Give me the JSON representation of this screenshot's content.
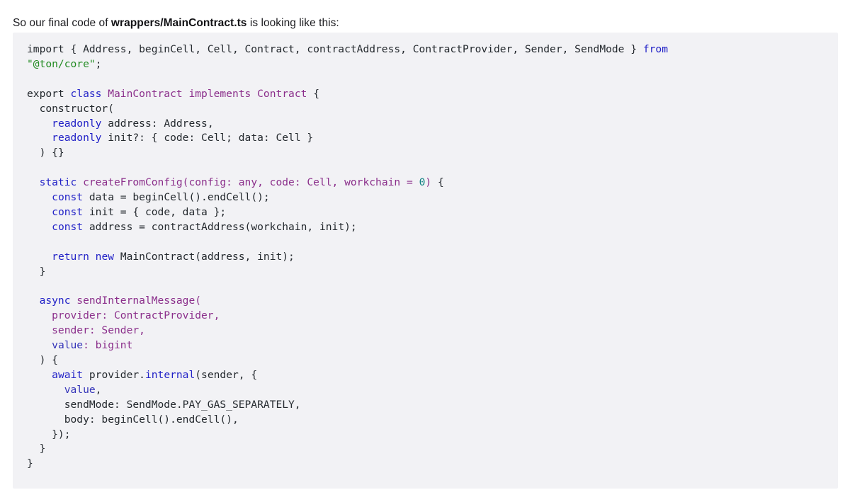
{
  "intro": {
    "prefix": "So our final code of ",
    "filename": "wrappers/MainContract.ts",
    "suffix": " is looking like this:"
  },
  "code_block": {
    "language": "typescript",
    "background_color": "#f2f2f5",
    "theme_colors": {
      "keyword": "#2222c7",
      "type": "#8b2f8b",
      "string": "#228b22",
      "number": "#0d8080",
      "plain": "#24292e"
    },
    "lines": [
      [
        {
          "t": "import { Address, beginCell, Cell, Contract, contractAddress, ContractProvider, Sender, SendMode } ",
          "c": "tok-pln"
        },
        {
          "t": "from",
          "c": "tok-kw"
        }
      ],
      [
        {
          "t": "\"@ton/core\"",
          "c": "tok-str"
        },
        {
          "t": ";",
          "c": "tok-pln"
        }
      ],
      [],
      [
        {
          "t": "export ",
          "c": "tok-pln"
        },
        {
          "t": "class ",
          "c": "tok-kw"
        },
        {
          "t": "MainContract ",
          "c": "tok-typ"
        },
        {
          "t": "implements ",
          "c": "tok-typ"
        },
        {
          "t": "Contract ",
          "c": "tok-typ"
        },
        {
          "t": "{",
          "c": "tok-pln"
        }
      ],
      [
        {
          "t": "  constructor(",
          "c": "tok-pln"
        }
      ],
      [
        {
          "t": "    ",
          "c": "tok-pln"
        },
        {
          "t": "readonly",
          "c": "tok-kw"
        },
        {
          "t": " address: Address,",
          "c": "tok-pln"
        }
      ],
      [
        {
          "t": "    ",
          "c": "tok-pln"
        },
        {
          "t": "readonly",
          "c": "tok-kw"
        },
        {
          "t": " init?: { code: Cell; data: Cell }",
          "c": "tok-pln"
        }
      ],
      [
        {
          "t": "  ) {}",
          "c": "tok-pln"
        }
      ],
      [],
      [
        {
          "t": "  ",
          "c": "tok-pln"
        },
        {
          "t": "static ",
          "c": "tok-kw"
        },
        {
          "t": "createFromConfig(config: any, code: Cell, workchain = ",
          "c": "tok-fn"
        },
        {
          "t": "0",
          "c": "tok-num"
        },
        {
          "t": ")",
          "c": "tok-typ"
        },
        {
          "t": " {",
          "c": "tok-pln"
        }
      ],
      [
        {
          "t": "    ",
          "c": "tok-pln"
        },
        {
          "t": "const",
          "c": "tok-kw"
        },
        {
          "t": " data = beginCell().endCell();",
          "c": "tok-pln"
        }
      ],
      [
        {
          "t": "    ",
          "c": "tok-pln"
        },
        {
          "t": "const",
          "c": "tok-kw"
        },
        {
          "t": " init = { code, data };",
          "c": "tok-pln"
        }
      ],
      [
        {
          "t": "    ",
          "c": "tok-pln"
        },
        {
          "t": "const",
          "c": "tok-kw"
        },
        {
          "t": " address = contractAddress(workchain, init);",
          "c": "tok-pln"
        }
      ],
      [],
      [
        {
          "t": "    ",
          "c": "tok-pln"
        },
        {
          "t": "return ",
          "c": "tok-kw"
        },
        {
          "t": "new ",
          "c": "tok-kw"
        },
        {
          "t": "MainContract(address, init);",
          "c": "tok-pln"
        }
      ],
      [
        {
          "t": "  }",
          "c": "tok-pln"
        }
      ],
      [],
      [
        {
          "t": "  ",
          "c": "tok-pln"
        },
        {
          "t": "async ",
          "c": "tok-kw"
        },
        {
          "t": "sendInternalMessage(",
          "c": "tok-fn"
        }
      ],
      [
        {
          "t": "    provider: ContractProvider,",
          "c": "tok-typ"
        }
      ],
      [
        {
          "t": "    sender: Sender,",
          "c": "tok-typ"
        }
      ],
      [
        {
          "t": "    ",
          "c": "tok-pln"
        },
        {
          "t": "value",
          "c": "tok-var"
        },
        {
          "t": ": bigint",
          "c": "tok-typ"
        }
      ],
      [
        {
          "t": "  ) {",
          "c": "tok-pln"
        }
      ],
      [
        {
          "t": "    ",
          "c": "tok-pln"
        },
        {
          "t": "await",
          "c": "tok-kw"
        },
        {
          "t": " provider.",
          "c": "tok-pln"
        },
        {
          "t": "internal",
          "c": "tok-kw"
        },
        {
          "t": "(sender, {",
          "c": "tok-pln"
        }
      ],
      [
        {
          "t": "      ",
          "c": "tok-pln"
        },
        {
          "t": "value",
          "c": "tok-var"
        },
        {
          "t": ",",
          "c": "tok-pln"
        }
      ],
      [
        {
          "t": "      sendMode: SendMode.PAY_GAS_SEPARATELY,",
          "c": "tok-pln"
        }
      ],
      [
        {
          "t": "      body: beginCell().endCell(),",
          "c": "tok-pln"
        }
      ],
      [
        {
          "t": "    });",
          "c": "tok-pln"
        }
      ],
      [
        {
          "t": "  }",
          "c": "tok-pln"
        }
      ],
      [
        {
          "t": "}",
          "c": "tok-pln"
        }
      ]
    ]
  }
}
